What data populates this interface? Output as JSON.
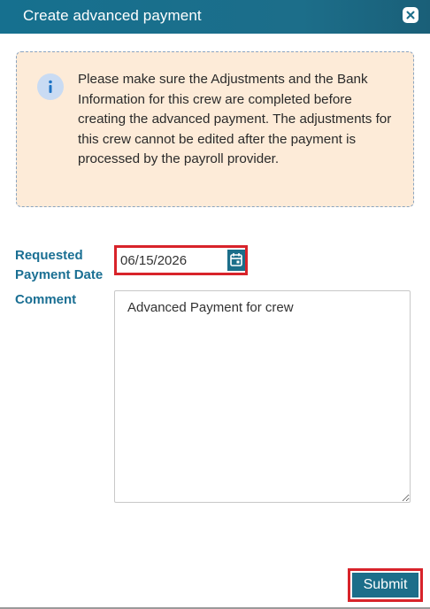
{
  "dialog": {
    "title": "Create advanced payment",
    "close_icon": "close-icon"
  },
  "notice": {
    "icon": "info-icon",
    "message": "Please make sure the Adjustments and the Bank Information for this crew are completed before creating the advanced payment. The adjustments for this crew cannot be edited after the payment is processed by the payroll provider."
  },
  "form": {
    "requested_date_label_line1": "Requested",
    "requested_date_label_line2": "Payment Date",
    "requested_date_value": "06/15/2026",
    "calendar_icon": "calendar-icon",
    "comment_label": "Comment",
    "comment_value": "Advanced Payment for crew"
  },
  "actions": {
    "submit_label": "Submit"
  },
  "colors": {
    "header": "#1c6e8a",
    "accent_label": "#1a6f93",
    "notice_bg": "#fdebd8",
    "highlight": "#d8232a"
  }
}
